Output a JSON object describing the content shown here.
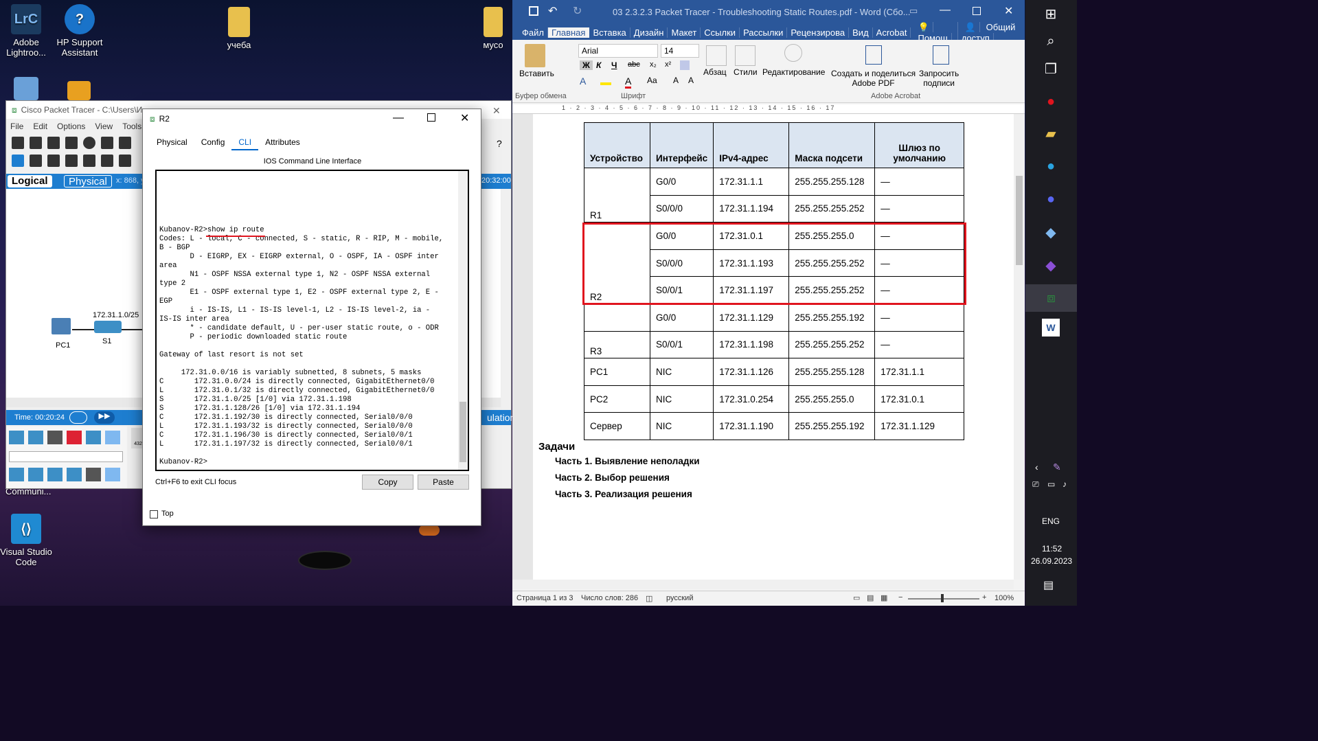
{
  "desktop": {
    "icons": [
      {
        "label": "Adobe\nLightroo...",
        "glyph": "LrC",
        "color": "#1b3b5f"
      },
      {
        "label": "HP Support\nAssistant",
        "glyph": "?",
        "color": "#1a73c9"
      },
      {
        "label": "учеба",
        "glyph": "",
        "color": "#e8c04d"
      },
      {
        "label": "мусо",
        "glyph": "",
        "color": "#e8c04d"
      },
      {
        "label": "Communi...",
        "glyph": "",
        "color": "#444"
      },
      {
        "label": "Visual Studio\nCode",
        "glyph": "",
        "color": "#1f8ad2"
      }
    ]
  },
  "packet_tracer": {
    "title": "Cisco Packet Tracer - C:\\Users\\И",
    "menu": [
      "File",
      "Edit",
      "Options",
      "View",
      "Tools",
      "E"
    ],
    "logical": "Logical",
    "physical": "Physical",
    "coords": "x: 868, y",
    "clock": "20:32:00",
    "time": "Time: 00:20:24",
    "simulation": "ulation",
    "net_label": "172.31.1.0/25",
    "pc": "PC1",
    "switch": "S1",
    "small_dev": "4321"
  },
  "r2": {
    "title": "R2",
    "tabs": [
      "Physical",
      "Config",
      "CLI",
      "Attributes"
    ],
    "heading": "IOS Command Line Interface",
    "cli_lines": [
      "Kubanov-R2>show ip route",
      "Codes: L - local, C - connected, S - static, R - RIP, M - mobile,",
      "B - BGP",
      "       D - EIGRP, EX - EIGRP external, O - OSPF, IA - OSPF inter",
      "area",
      "       N1 - OSPF NSSA external type 1, N2 - OSPF NSSA external",
      "type 2",
      "       E1 - OSPF external type 1, E2 - OSPF external type 2, E -",
      "EGP",
      "       i - IS-IS, L1 - IS-IS level-1, L2 - IS-IS level-2, ia -",
      "IS-IS inter area",
      "       * - candidate default, U - per-user static route, o - ODR",
      "       P - periodic downloaded static route",
      "",
      "Gateway of last resort is not set",
      "",
      "     172.31.0.0/16 is variably subnetted, 8 subnets, 5 masks",
      "C       172.31.0.0/24 is directly connected, GigabitEthernet0/0",
      "L       172.31.0.1/32 is directly connected, GigabitEthernet0/0",
      "S       172.31.1.0/25 [1/0] via 172.31.1.198",
      "S       172.31.1.128/26 [1/0] via 172.31.1.194",
      "C       172.31.1.192/30 is directly connected, Serial0/0/0",
      "L       172.31.1.193/32 is directly connected, Serial0/0/0",
      "C       172.31.1.196/30 is directly connected, Serial0/0/1",
      "L       172.31.1.197/32 is directly connected, Serial0/0/1",
      "",
      "Kubanov-R2>"
    ],
    "hint": "Ctrl+F6 to exit CLI focus",
    "copy": "Copy",
    "paste": "Paste",
    "top": "Top"
  },
  "word": {
    "title": "03 2.3.2.3 Packet Tracer - Troubleshooting Static Routes.pdf - Word (Сбо...",
    "tabs": [
      "Файл",
      "Главная",
      "Вставка",
      "Дизайн",
      "Макет",
      "Ссылки",
      "Рассылки",
      "Рецензирова",
      "Вид",
      "Acrobat",
      "Помош",
      "Общий доступ"
    ],
    "ribbon": {
      "paste": "Вставить",
      "font": "Arial",
      "size": "14",
      "paragraph": "Абзац",
      "styles": "Стили",
      "editing": "Редактирование",
      "create_pdf": "Создать и поделиться\nAdobe PDF",
      "request_sign": "Запросить\nподписи",
      "clipboard": "Буфер обмена",
      "font_group": "Шрифт",
      "acrobat_group": "Adobe Acrobat",
      "bold": "Ж",
      "italic": "К",
      "underline": "Ч"
    },
    "ruler": "1 · 2 · 3 · 4 · 5 · 6 · 7 · 8 · 9 · 10 · 11 · 12 · 13 · 14 · 15 · 16 · 17",
    "table": {
      "headers": [
        "Устройство",
        "Интерфейс",
        "IPv4-адрес",
        "Маска подсети",
        "Шлюз по умолчанию"
      ],
      "rows": [
        [
          "",
          "G0/0",
          "172.31.1.1",
          "255.255.255.128",
          "—"
        ],
        [
          "R1",
          "S0/0/0",
          "172.31.1.194",
          "255.255.255.252",
          "—"
        ],
        [
          "",
          "G0/0",
          "172.31.0.1",
          "255.255.255.0",
          "—"
        ],
        [
          "",
          "S0/0/0",
          "172.31.1.193",
          "255.255.255.252",
          "—"
        ],
        [
          "R2",
          "S0/0/1",
          "172.31.1.197",
          "255.255.255.252",
          "—"
        ],
        [
          "",
          "G0/0",
          "172.31.1.129",
          "255.255.255.192",
          "—"
        ],
        [
          "R3",
          "S0/0/1",
          "172.31.1.198",
          "255.255.255.252",
          "—"
        ],
        [
          "PC1",
          "NIC",
          "172.31.1.126",
          "255.255.255.128",
          "172.31.1.1"
        ],
        [
          "PC2",
          "NIC",
          "172.31.0.254",
          "255.255.255.0",
          "172.31.0.1"
        ],
        [
          "Сервер",
          "NIC",
          "172.31.1.190",
          "255.255.255.192",
          "172.31.1.129"
        ]
      ]
    },
    "tasks_heading": "Задачи",
    "tasks": [
      "Часть 1. Выявление неполадки",
      "Часть 2. Выбор решения",
      "Часть 3. Реализация решения"
    ],
    "status": {
      "page": "Страница 1 из 3",
      "words": "Число слов: 286",
      "lang": "русский",
      "zoom": "100%"
    }
  },
  "taskbar": {
    "lang": "ENG",
    "time": "11:52",
    "date": "26.09.2023"
  },
  "colors": {
    "word_blue": "#2b579a",
    "highlight_red": "#e0141e",
    "pt_blue": "#1e7ed0"
  }
}
